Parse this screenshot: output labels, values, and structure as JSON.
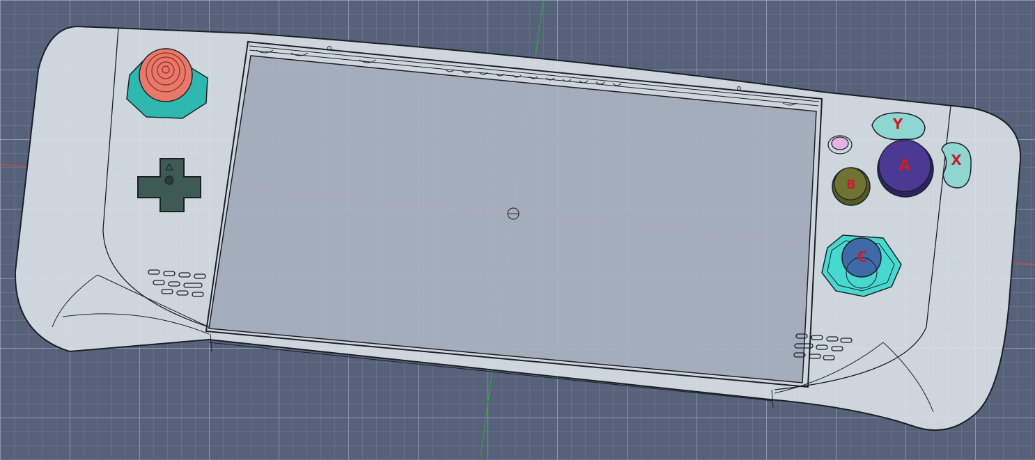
{
  "scene": {
    "background_color": "#56617a",
    "body_color": "#d7dee3",
    "outline_color": "#1c1f24",
    "axis_x_color": "#d64545",
    "axis_y_color": "#2fa83a"
  },
  "controls": {
    "left_stick": {
      "cap_color": "#e8786a",
      "base_color": "#2fb8b0",
      "icon": "concentric-rings-icon"
    },
    "dpad": {
      "color": "#3e5a55",
      "icon": "dpad-cross-icon"
    },
    "menu_button": {
      "color": "#e7b1e8"
    },
    "button_y": {
      "label": "Y",
      "color": "#8fd6d3"
    },
    "button_a": {
      "label": "A",
      "color": "#4b3a93"
    },
    "button_x": {
      "label": "X",
      "color": "#8fd6d3"
    },
    "button_b": {
      "label": "B",
      "color": "#6f7433"
    },
    "right_stick": {
      "label": "C",
      "cap_color": "#3f6aa8",
      "base_color": "#47d9d0"
    }
  },
  "legend": {
    "speaker_left": "speaker-grille-icon",
    "speaker_right": "speaker-grille-icon",
    "origin_marker": "origin-crosshair-icon"
  }
}
